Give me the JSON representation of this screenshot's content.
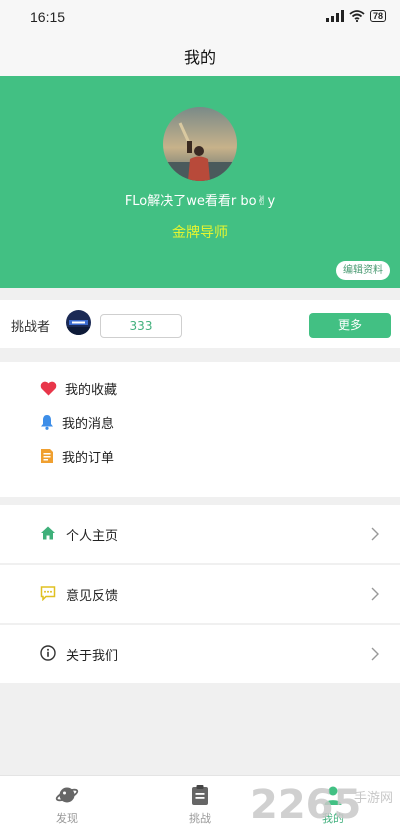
{
  "status_bar": {
    "time": "16:15",
    "battery": "78",
    "icons": [
      "signal-icon",
      "wifi-icon",
      "battery-icon"
    ]
  },
  "header": {
    "title": "我的"
  },
  "profile": {
    "username": "FLo解决了we看看r bo✌y",
    "role": "金牌导师",
    "edit_label": "编辑资料"
  },
  "challenger": {
    "label": "挑战者",
    "count": "333",
    "more_label": "更多"
  },
  "menu": {
    "items": [
      {
        "label": "我的收藏",
        "icon": "heart-icon"
      },
      {
        "label": "我的消息",
        "icon": "bell-icon"
      },
      {
        "label": "我的订单",
        "icon": "order-icon"
      }
    ]
  },
  "links": {
    "items": [
      {
        "label": "个人主页",
        "icon": "home-icon"
      },
      {
        "label": "意见反馈",
        "icon": "feedback-icon"
      },
      {
        "label": "关于我们",
        "icon": "info-icon"
      }
    ]
  },
  "tabs": {
    "items": [
      {
        "label": "发现",
        "icon": "planet-icon"
      },
      {
        "label": "挑战",
        "icon": "clipboard-icon"
      },
      {
        "label": "我的",
        "icon": "person-icon"
      }
    ],
    "active": "我的"
  },
  "watermark": {
    "number": "2265",
    "sub": "手游网"
  },
  "colors": {
    "accent": "#42c083",
    "role_text": "#e5f530",
    "heart": "#e8364a",
    "bell": "#3d8ee8",
    "order": "#f0a030",
    "home": "#3fb07a",
    "feedback": "#e0c020"
  }
}
